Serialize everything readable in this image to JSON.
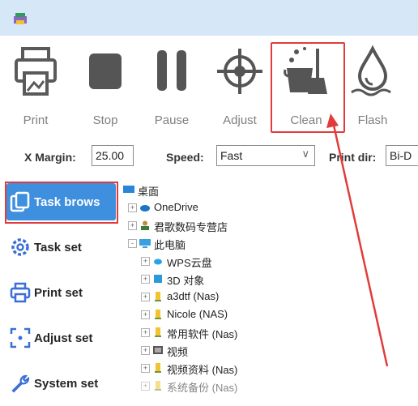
{
  "toolbar": {
    "items": [
      {
        "label": "Print",
        "icon": "printer-icon"
      },
      {
        "label": "Stop",
        "icon": "stop-icon"
      },
      {
        "label": "Pause",
        "icon": "pause-icon"
      },
      {
        "label": "Adjust",
        "icon": "crosshair-icon"
      },
      {
        "label": "Clean",
        "icon": "clean-bucket-icon"
      },
      {
        "label": "Flash",
        "icon": "ink-drop-icon"
      }
    ]
  },
  "options": {
    "x_margin_label": "X Margin:",
    "x_margin_value": "25.00",
    "speed_label": "Speed:",
    "speed_value": "Fast",
    "print_dir_label": "Print dir:",
    "print_dir_value": "Bi-D"
  },
  "sidebar": {
    "items": [
      {
        "label": "Task brows",
        "icon": "folder-copy-icon"
      },
      {
        "label": "Task set",
        "icon": "gear-icon"
      },
      {
        "label": "Print set",
        "icon": "printer-icon"
      },
      {
        "label": "Adjust set",
        "icon": "adjust-icon"
      },
      {
        "label": "System set",
        "icon": "wrench-icon"
      }
    ]
  },
  "tree": {
    "nodes": [
      {
        "label": "桌面",
        "icon": "desktop-icon",
        "expander": ""
      },
      {
        "label": "OneDrive",
        "icon": "cloud-icon",
        "expander": "+"
      },
      {
        "label": "君歌数码专营店",
        "icon": "user-icon",
        "expander": "+"
      },
      {
        "label": "此电脑",
        "icon": "computer-icon",
        "expander": "-"
      },
      {
        "label": "WPS云盘",
        "icon": "cloud-icon",
        "expander": "+"
      },
      {
        "label": "3D 对象",
        "icon": "cube-icon",
        "expander": "+"
      },
      {
        "label": "a3dtf (Nas)",
        "icon": "drive-icon",
        "expander": "+"
      },
      {
        "label": "Nicole (NAS)",
        "icon": "drive-icon",
        "expander": "+"
      },
      {
        "label": "常用软件 (Nas)",
        "icon": "drive-icon",
        "expander": "+"
      },
      {
        "label": "视频",
        "icon": "video-icon",
        "expander": "+"
      },
      {
        "label": "视频资料 (Nas)",
        "icon": "drive-icon",
        "expander": "+"
      },
      {
        "label": "系统备份 (Nas)",
        "icon": "drive-icon",
        "expander": "+"
      }
    ]
  },
  "colors": {
    "accent": "#3e8fde",
    "highlight": "#e23b3b",
    "titlebar": "#d6e7f8"
  }
}
